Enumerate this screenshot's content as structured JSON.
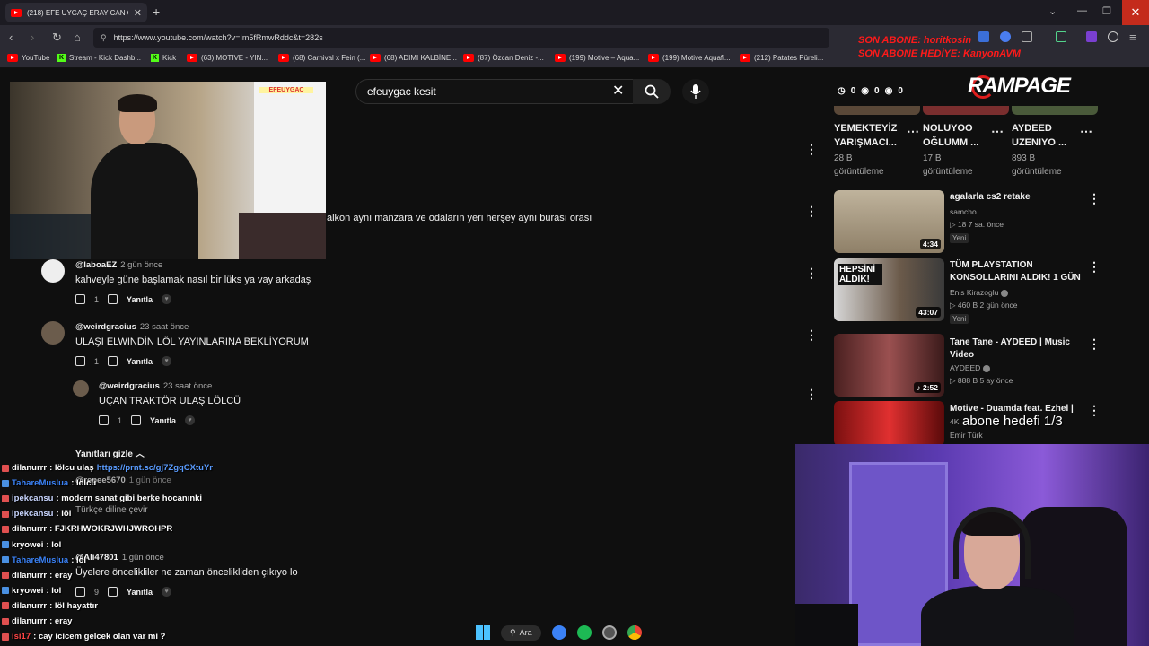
{
  "browser": {
    "tab_title": "(218) EFE UYGAÇ ERAY CAN Ö...",
    "url": "https://www.youtube.com/watch?v=Im5fRmwRddc&t=282s",
    "bookmarks": [
      "YouTube",
      "Stream - Kick Dashb...",
      "Kick",
      "(63) MOTIVE - YIN...",
      "(68) Carnival x Fein (...",
      "(68) ADIMI KALBİNE...",
      "(87) Özcan Deniz -...",
      "(199) Motive – Aqua...",
      "(199) Motive Aquafi...",
      "(212) Patates Püreli..."
    ]
  },
  "overlay": {
    "line1": "SON ABONE: horitkosin",
    "line2": "SON ABONE HEDİYE: KanyonAVM",
    "brand": "RAMPAGE",
    "sub_goal": "abone hedefi 1/3",
    "counters": [
      "0",
      "0",
      "0"
    ]
  },
  "search": {
    "query": "efeuygac kesit"
  },
  "comments": {
    "partial_text": "alkon aynı manzara ve odaların yeri herşey aynı burası orası",
    "items": [
      {
        "handle": "@laboaEZ",
        "time": "2 gün önce",
        "text": "kahveyle güne başlamak nasıl bir lüks ya vay arkadaş",
        "likes": "1",
        "reply": "Yanıtla"
      },
      {
        "handle": "@weirdgracius",
        "time": "23 saat önce",
        "text": "ULAŞI ELWINDİN LÖL YAYINLARINA BEKLİYORUM",
        "likes": "1",
        "reply": "Yanıtla"
      },
      {
        "handle": "@weirdgracius",
        "time": "23 saat önce",
        "text": "UÇAN TRAKTÖR ULAŞ LÖLCÜ",
        "likes": "1",
        "reply": "Yanıtla"
      },
      {
        "handle": "@repee5670",
        "time": "1 gün önce",
        "text": "",
        "likes": "",
        "reply": ""
      },
      {
        "handle": "@Ali47801",
        "time": "1 gün önce",
        "text": "Üyelere öncelikliler ne zaman öncelikliden çıkıyo lo",
        "likes": "9",
        "reply": "Yanıtla"
      }
    ],
    "hide_replies": "Yanıtları gizle",
    "translate": "Türkçe diline çevir"
  },
  "chat": [
    {
      "user": "dilanurrr",
      "msg": " : lölcu ulaş ",
      "link": "https://prnt.sc/gj7ZgqCXtuYr",
      "color": "#ffffff"
    },
    {
      "user": "TahareMuslua",
      "msg": " : lölcü",
      "link": "",
      "color": "#3b82f6"
    },
    {
      "user": "ipekcansu",
      "msg": " : modern sanat gibi berke hocanınki",
      "link": "",
      "color": "#c9d6ff"
    },
    {
      "user": "ipekcansu",
      "msg": " : löl",
      "link": "",
      "color": "#c9d6ff"
    },
    {
      "user": "dilanurrr",
      "msg": " : FJKRHWOKRJWHJWROHPR",
      "link": "",
      "color": "#ffffff"
    },
    {
      "user": "kryowei",
      "msg": " : lol",
      "link": "",
      "color": "#ffffff"
    },
    {
      "user": "TahareMuslua",
      "msg": " : löl",
      "link": "",
      "color": "#3b82f6"
    },
    {
      "user": "dilanurrr",
      "msg": " : eray",
      "link": "",
      "color": "#ffffff"
    },
    {
      "user": "kryowei",
      "msg": " : lol",
      "link": "",
      "color": "#ffffff"
    },
    {
      "user": "dilanurrr",
      "msg": " : löl hayattır",
      "link": "",
      "color": "#ffffff"
    },
    {
      "user": "dilanurrr",
      "msg": " : eray",
      "link": "",
      "color": "#ffffff"
    },
    {
      "user": "isi17",
      "msg": " : cay icicem gelcek olan var mi ?",
      "link": "",
      "color": "#ff4444"
    }
  ],
  "sidebar": {
    "top_row": [
      {
        "title_1": "YEMEKTEYİZ",
        "title_2": "YARIŞMACI...",
        "views": "28 B",
        "views_label": "görüntüleme"
      },
      {
        "title_1": "NOLUYOO",
        "title_2": "OĞLUMM ...",
        "views": "17 B",
        "views_label": "görüntüleme"
      },
      {
        "title_1": "AYDEED",
        "title_2": "UZENIYO ...",
        "views": "893 B",
        "views_label": "görüntüleme"
      }
    ],
    "videos": [
      {
        "title": "agalarla cs2 retake",
        "channel": "samcho",
        "stats": "▷ 18  7 sa. önce",
        "badge": "Yeni",
        "duration": "4:34"
      },
      {
        "title": "TÜM PLAYSTATION KONSOLLARINI ALDIK! 1 GÜN ...",
        "channel": "Enis Kirazoglu",
        "stats": "▷ 460 B  2 gün önce",
        "badge": "Yeni",
        "duration": "43:07",
        "thumb_text": "HEPSİNİ ALDIK!"
      },
      {
        "title": "Tane Tane - AYDEED | Music Video",
        "channel": "AYDEED",
        "stats": "▷ 888 B  5 ay önce",
        "badge": "",
        "duration": "♪ 2:52"
      },
      {
        "title": "Motive - Duamda feat. Ezhel |",
        "channel": "Emir Türk",
        "stats": "",
        "badge": "",
        "duration": "",
        "res": "4K"
      }
    ]
  },
  "taskbar": {
    "search_label": "Ara"
  },
  "colors": {
    "yt_red": "#ff0000",
    "bg": "#0f0f0f",
    "overlay_red": "#ff1a1a",
    "close_red": "#c42b1c"
  }
}
